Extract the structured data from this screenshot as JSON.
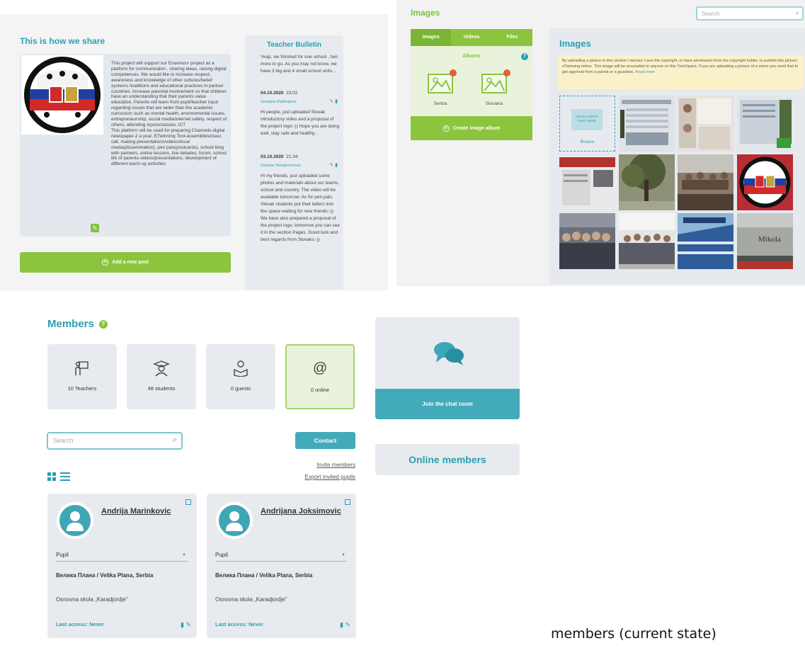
{
  "share": {
    "title": "This is how we share",
    "text": "This project will support our Erasmus+ project as a platform for communicaton , sharing ideas, raising digital competences. We would like to increase respect, awareness and knowledge of other cultures/belief systems /traditions and educational practices in partner countries. Increase parental involvement so that children have an understanding that their parents value education. Parents will learn from pupil/teacher input regarding issues that are wider than the academic curriculum such as mental health, environmental issues, entrepreneurship, social media/internet safety, respect of others, attending inputs/classes, ICT\nThis platform will be used for preparing Channels-digital newspaper-2 a year, ETwinning Tool-assemblies/class call, making presentations/videos/local media(dissemination), pen pals(postcards), school blog with partners, online lessons, live debates, forum, school life of parents-videos/presentations, development of different warm up activities",
    "add_post_label": "Add a new post"
  },
  "bulletin": {
    "title": "Teacher Bulletin",
    "posts": [
      {
        "text": "Yeap, we finished for one school , two more to go. As you may not know, we have 3 big and 4 small school units..."
      },
      {
        "date": "04.10.2020",
        "time": "23:02",
        "author": "Gordana Radivojevic",
        "text": "Hi people, just uploaded Slovak introductory video and a proposal of the project logo:-)) Hope you are doing well, stay safe and healthy..."
      },
      {
        "date": "03.10.2020",
        "time": "21:34",
        "author": "Daniela Tomajkovičová",
        "text": "Hi my friends, just uploaded some photos and materials about our teams, school and country. The video will be available tomorrow. As for pen pals, Slovak students put their letters into the space waiting for new friends:-)) We have also prepared a proposal of the project logo, tomorrow you can see it in the section Pages. Good luck and best regards from Slovaks:-))"
      }
    ]
  },
  "images": {
    "title": "Images",
    "search_placeholder": "Search",
    "tabs": [
      "Images",
      "Videos",
      "Files"
    ],
    "albums_label": "Albums",
    "albums": [
      "Serbia",
      "Slovakia"
    ],
    "create_album_label": "Create image album",
    "gallery_title": "Images",
    "notice": "By uploading a picture in this section I declare I own the copyright, or have permission from the copyright holder, to publish this picture, eTwinning notice. This image will be accessible to anyone on this TwinSpace. If you are uploading a picture of a minor you need that to get approval from a parent or a guardian.",
    "read_more": "Read more",
    "upload_placeholder": "DRAG & DROP FILES HERE",
    "browse_label": "Browse",
    "photo_sign_text": "Mikola"
  },
  "members": {
    "title": "Members",
    "stats": [
      {
        "icon": "teacher-icon",
        "label": "10 Teachers"
      },
      {
        "icon": "student-icon",
        "label": "48 students"
      },
      {
        "icon": "guest-icon",
        "label": "0 guests"
      },
      {
        "icon": "at-icon",
        "label": "0 online"
      }
    ],
    "search_placeholder": "Search",
    "contact_label": "Contact",
    "invite_label": "Invite members",
    "export_label": "Export invited pupils",
    "cards": [
      {
        "name": "Andrija Marinkovic",
        "role": "Pupil",
        "location": "Велика Плана / Velika Plana, Serbia",
        "school": "Osnovna skola „Karadjordje\"",
        "last_access": "Last access: Never"
      },
      {
        "name": "Andrijana Joksimovic",
        "role": "Pupil",
        "location": "Велика Плана / Velika Plana, Serbia",
        "school": "Osnovna skola „Karadjordje\"",
        "last_access": "Last access: Never"
      }
    ]
  },
  "chat": {
    "join_label": "Join the chat room",
    "online_members_label": "Online members"
  },
  "caption": "members (current state)",
  "colors": {
    "teal": "#2a9fb3",
    "green": "#8cc43e",
    "panel": "#e7ebef"
  }
}
